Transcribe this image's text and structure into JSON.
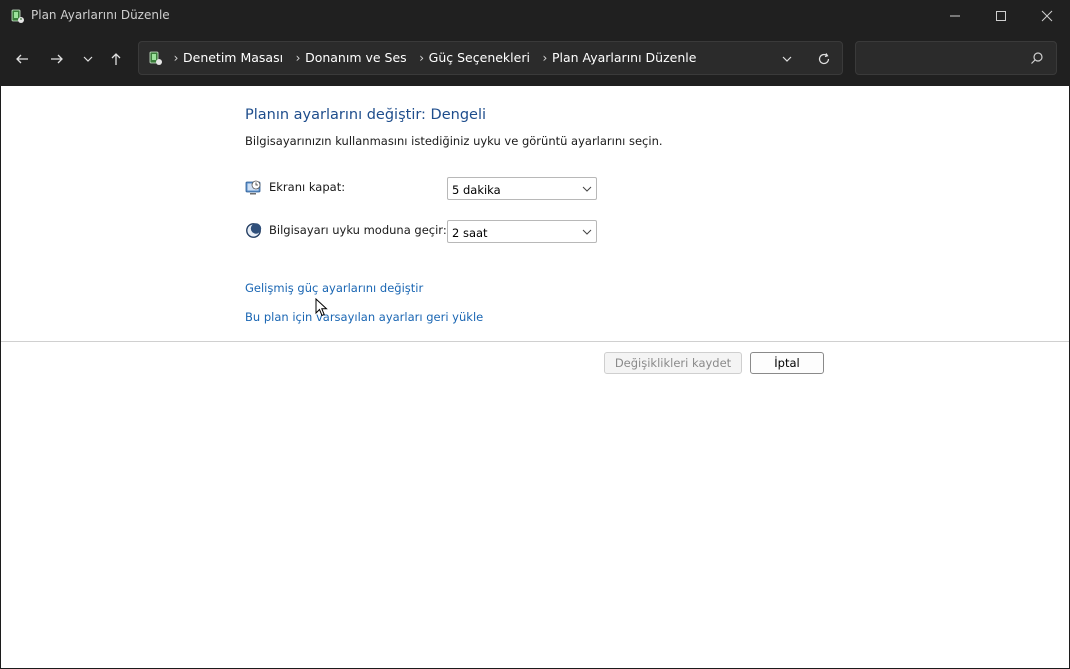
{
  "window": {
    "title": "Plan Ayarlarını Düzenle",
    "icon": "power-options-icon"
  },
  "nav": {
    "back": "arrow-left-icon",
    "forward": "arrow-right-icon",
    "recent": "chevron-down-icon",
    "up": "arrow-up-icon"
  },
  "address": {
    "crumbs": [
      "Denetim Masası",
      "Donanım ve Ses",
      "Güç Seçenekleri",
      "Plan Ayarlarını Düzenle"
    ]
  },
  "search": {
    "placeholder": "",
    "value": ""
  },
  "main": {
    "heading": "Planın ayarlarını değiştir: Dengeli",
    "description": "Bilgisayarınızın kullanmasını istediğiniz uyku ve görüntü ayarlarını seçin.",
    "settings": [
      {
        "label": "Ekranı kapat:",
        "value": "5 dakika",
        "icon": "display-timer-icon"
      },
      {
        "label": "Bilgisayarı uyku moduna geçir:",
        "value": "2 saat",
        "icon": "sleep-moon-icon"
      }
    ],
    "links": [
      "Gelişmiş güç ayarlarını değiştir",
      "Bu plan için varsayılan ayarları geri yükle"
    ],
    "buttons": {
      "save": "Değişiklikleri kaydet",
      "cancel": "İptal"
    }
  },
  "colors": {
    "heading": "#1e4d8c",
    "link": "#1a66b3",
    "titlebar": "#202020"
  }
}
